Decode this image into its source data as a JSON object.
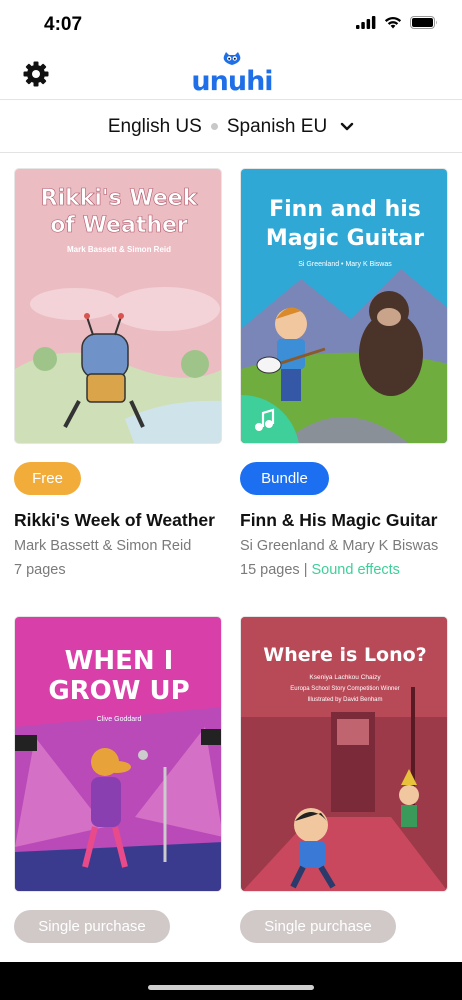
{
  "status_bar": {
    "time": "4:07"
  },
  "header": {
    "logo_text": "unuhi"
  },
  "language_bar": {
    "primary": "English US",
    "secondary": "Spanish EU"
  },
  "books": [
    {
      "cover_title_line1": "Rikki's Week",
      "cover_title_line2": "of Weather",
      "cover_authors": "Mark Bassett & Simon Reid",
      "badge": "Free",
      "title": "Rikki's Week of Weather",
      "authors": "Mark Bassett & Simon Reid",
      "pages": "7 pages"
    },
    {
      "cover_title_line1": "Finn and his",
      "cover_title_line2": "Magic Guitar",
      "cover_authors": "Si Greenland  •  Mary K Biswas",
      "badge": "Bundle",
      "title": "Finn & His Magic Guitar",
      "authors": "Si Greenland & Mary K Biswas",
      "pages": "15 pages",
      "pages_separator": " | ",
      "extra": "Sound effects"
    },
    {
      "cover_title_line1": "WHEN I",
      "cover_title_line2": "GROW UP",
      "cover_authors": "Clive Goddard",
      "badge": "Single purchase"
    },
    {
      "cover_title_line1": "Where is Lono?",
      "cover_sub1": "Kseniya Lachkou Chaizy",
      "cover_sub2": "Europa School Story Competition Winner",
      "cover_sub3": "Illustrated by David Benham",
      "badge": "Single purchase"
    }
  ]
}
